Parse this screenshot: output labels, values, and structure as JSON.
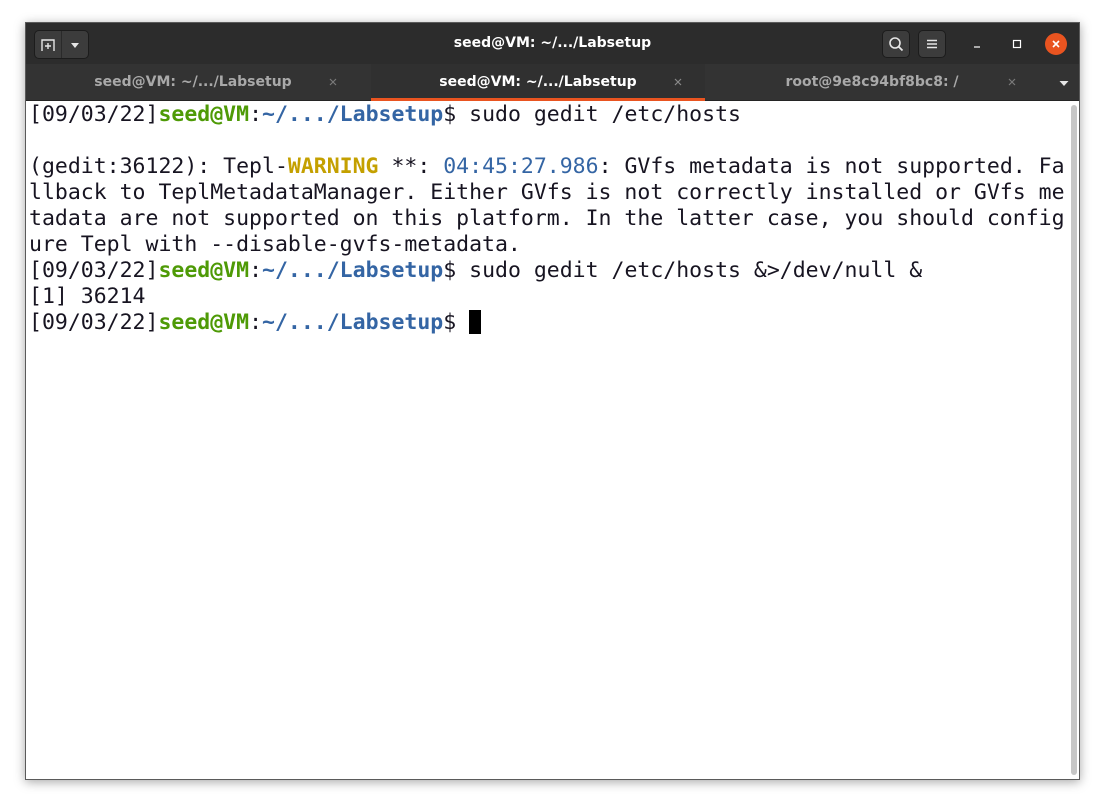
{
  "window": {
    "title": "seed@VM: ~/.../Labsetup"
  },
  "icons": {
    "new_tab": "new-tab-icon",
    "tab_dropdown": "chevron-down-icon",
    "search": "search-icon",
    "menu": "hamburger-menu-icon",
    "minimize": "minimize-icon",
    "maximize": "maximize-icon",
    "close": "close-icon"
  },
  "colors": {
    "accent": "#e95420",
    "prompt_user": "#4e9a06",
    "prompt_path": "#3465a4",
    "warning": "#c4a000"
  },
  "tabs": [
    {
      "label": "seed@VM: ~/.../Labsetup",
      "active": false
    },
    {
      "label": "seed@VM: ~/.../Labsetup",
      "active": true
    },
    {
      "label": "root@9e8c94bf8bc8: /",
      "active": false
    }
  ],
  "prompt": {
    "date": "[09/03/22]",
    "user": "seed@VM",
    "colon": ":",
    "path": "~/.../Labsetup",
    "symbol": "$"
  },
  "terminal": {
    "cmd1": " sudo gedit /etc/hosts",
    "blank": "",
    "warn_prefix": "(gedit:36122): Tepl-",
    "warn_word": "WARNING",
    "warn_mid": " **: ",
    "warn_time": "04:45:27.986",
    "warn_rest": ": GVfs metadata is not supported. Fa",
    "wrap2": "llback to TeplMetadataManager. Either GVfs is not correctly installed or GVfs me",
    "wrap3": "tadata are not supported on this platform. In the latter case, you should config",
    "wrap4": "ure Tepl with --disable-gvfs-metadata.",
    "cmd2": " sudo gedit /etc/hosts &>/dev/null &",
    "job": "[1] 36214",
    "cmd3": " "
  }
}
